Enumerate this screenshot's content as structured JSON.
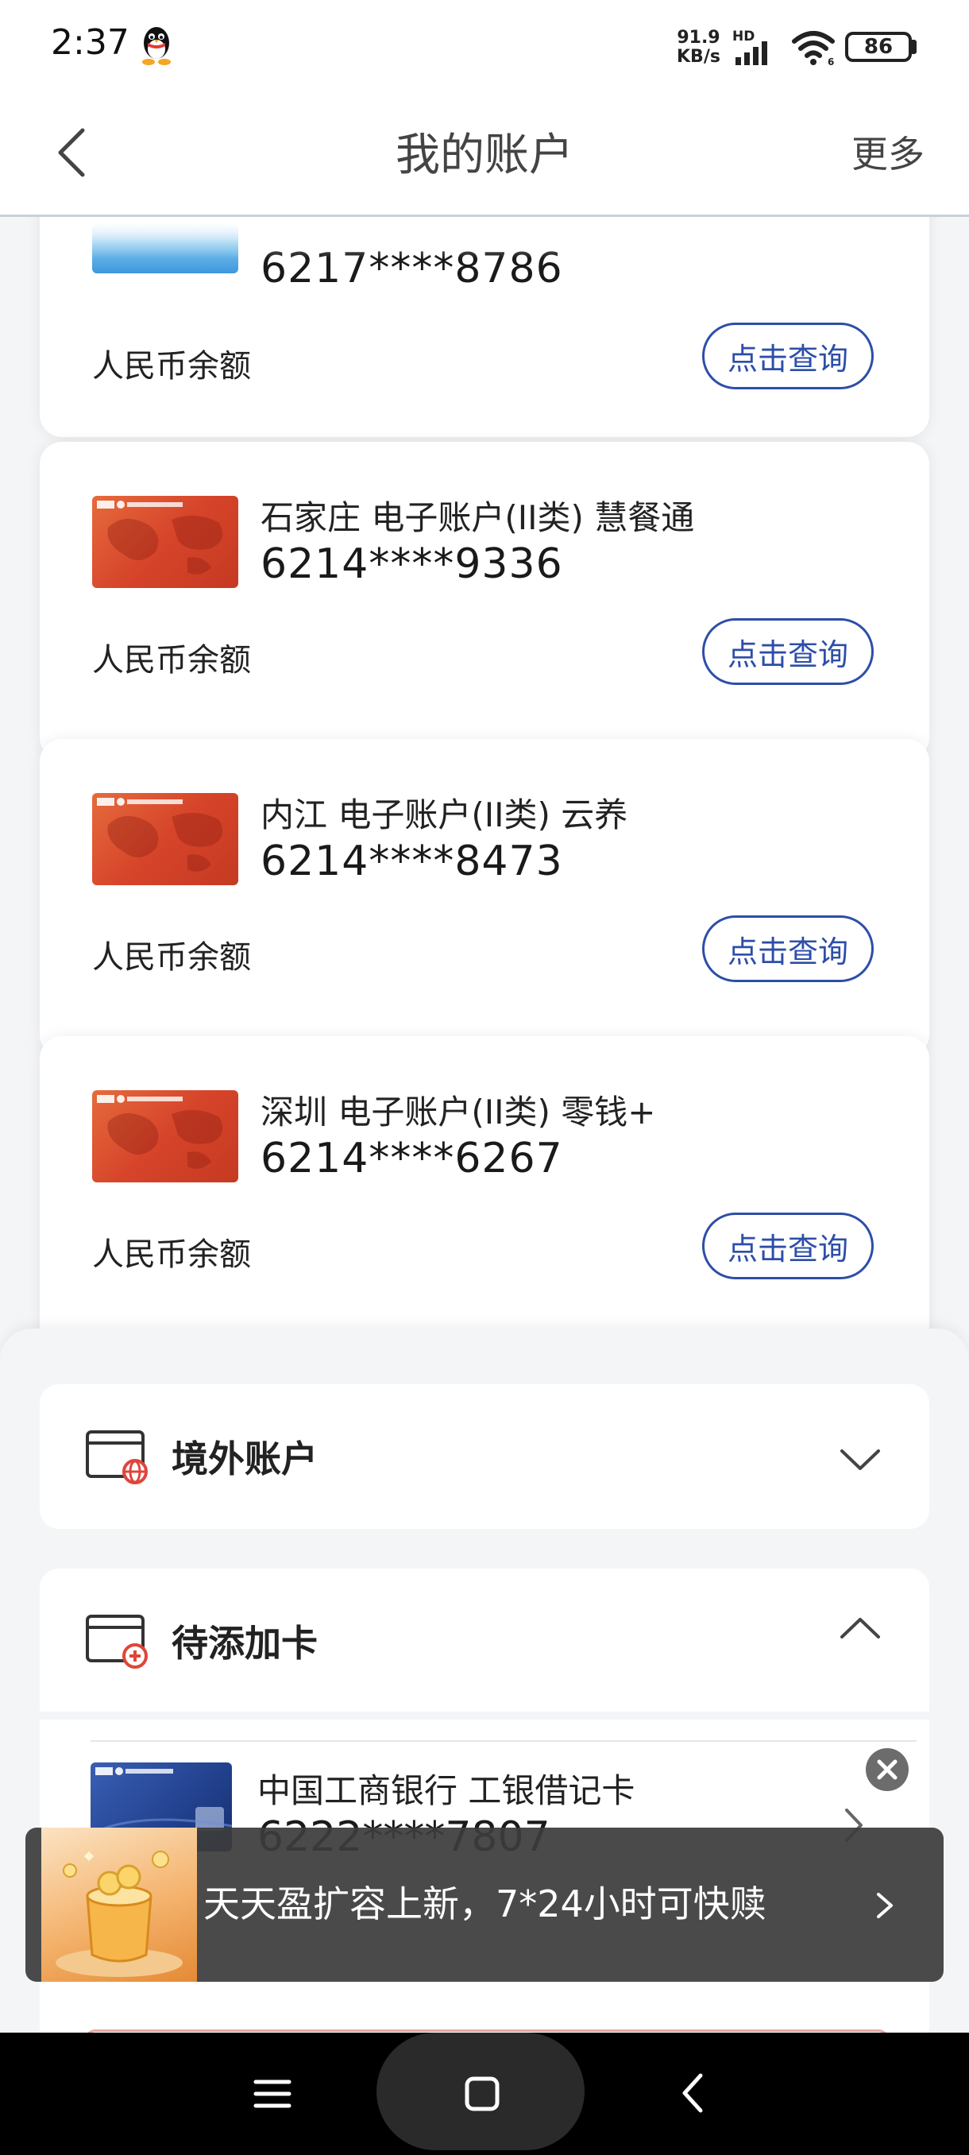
{
  "status_bar": {
    "time": "2:37",
    "net_speed_value": "91.9",
    "net_speed_unit": "KB/s",
    "network_label": "HD",
    "battery": "86"
  },
  "header": {
    "title": "我的账户",
    "more_label": "更多"
  },
  "accounts": [
    {
      "name": "",
      "number": "6217****8786",
      "balance_label": "人民币余额",
      "query_label": "点击查询",
      "card_color": "blue"
    },
    {
      "name": "石家庄 电子账户(II类) 慧餐通",
      "number": "6214****9336",
      "balance_label": "人民币余额",
      "query_label": "点击查询",
      "card_color": "red"
    },
    {
      "name": "内江 电子账户(II类) 云养",
      "number": "6214****8473",
      "balance_label": "人民币余额",
      "query_label": "点击查询",
      "card_color": "red"
    },
    {
      "name": "深圳 电子账户(II类) 零钱+",
      "number": "6214****6267",
      "balance_label": "人民币余额",
      "query_label": "点击查询",
      "card_color": "red"
    }
  ],
  "sections": {
    "overseas": {
      "title": "境外账户",
      "expanded": false
    },
    "pending": {
      "title": "待添加卡",
      "expanded": true,
      "cards": [
        {
          "name": "中国工商银行 工银借记卡",
          "number": "6222****7807"
        }
      ]
    }
  },
  "promo": {
    "text": "天天盈扩容上新，7*24小时可快赎"
  },
  "colors": {
    "accent": "#2d4ea8",
    "card_red": "#d6442a",
    "background": "#f4f5f7"
  },
  "icons": [
    "back-icon",
    "globe-card-icon",
    "add-card-icon",
    "chevron-down-icon",
    "chevron-up-icon",
    "chevron-right-icon",
    "close-icon",
    "menu-icon",
    "home-icon",
    "nav-back-icon"
  ]
}
